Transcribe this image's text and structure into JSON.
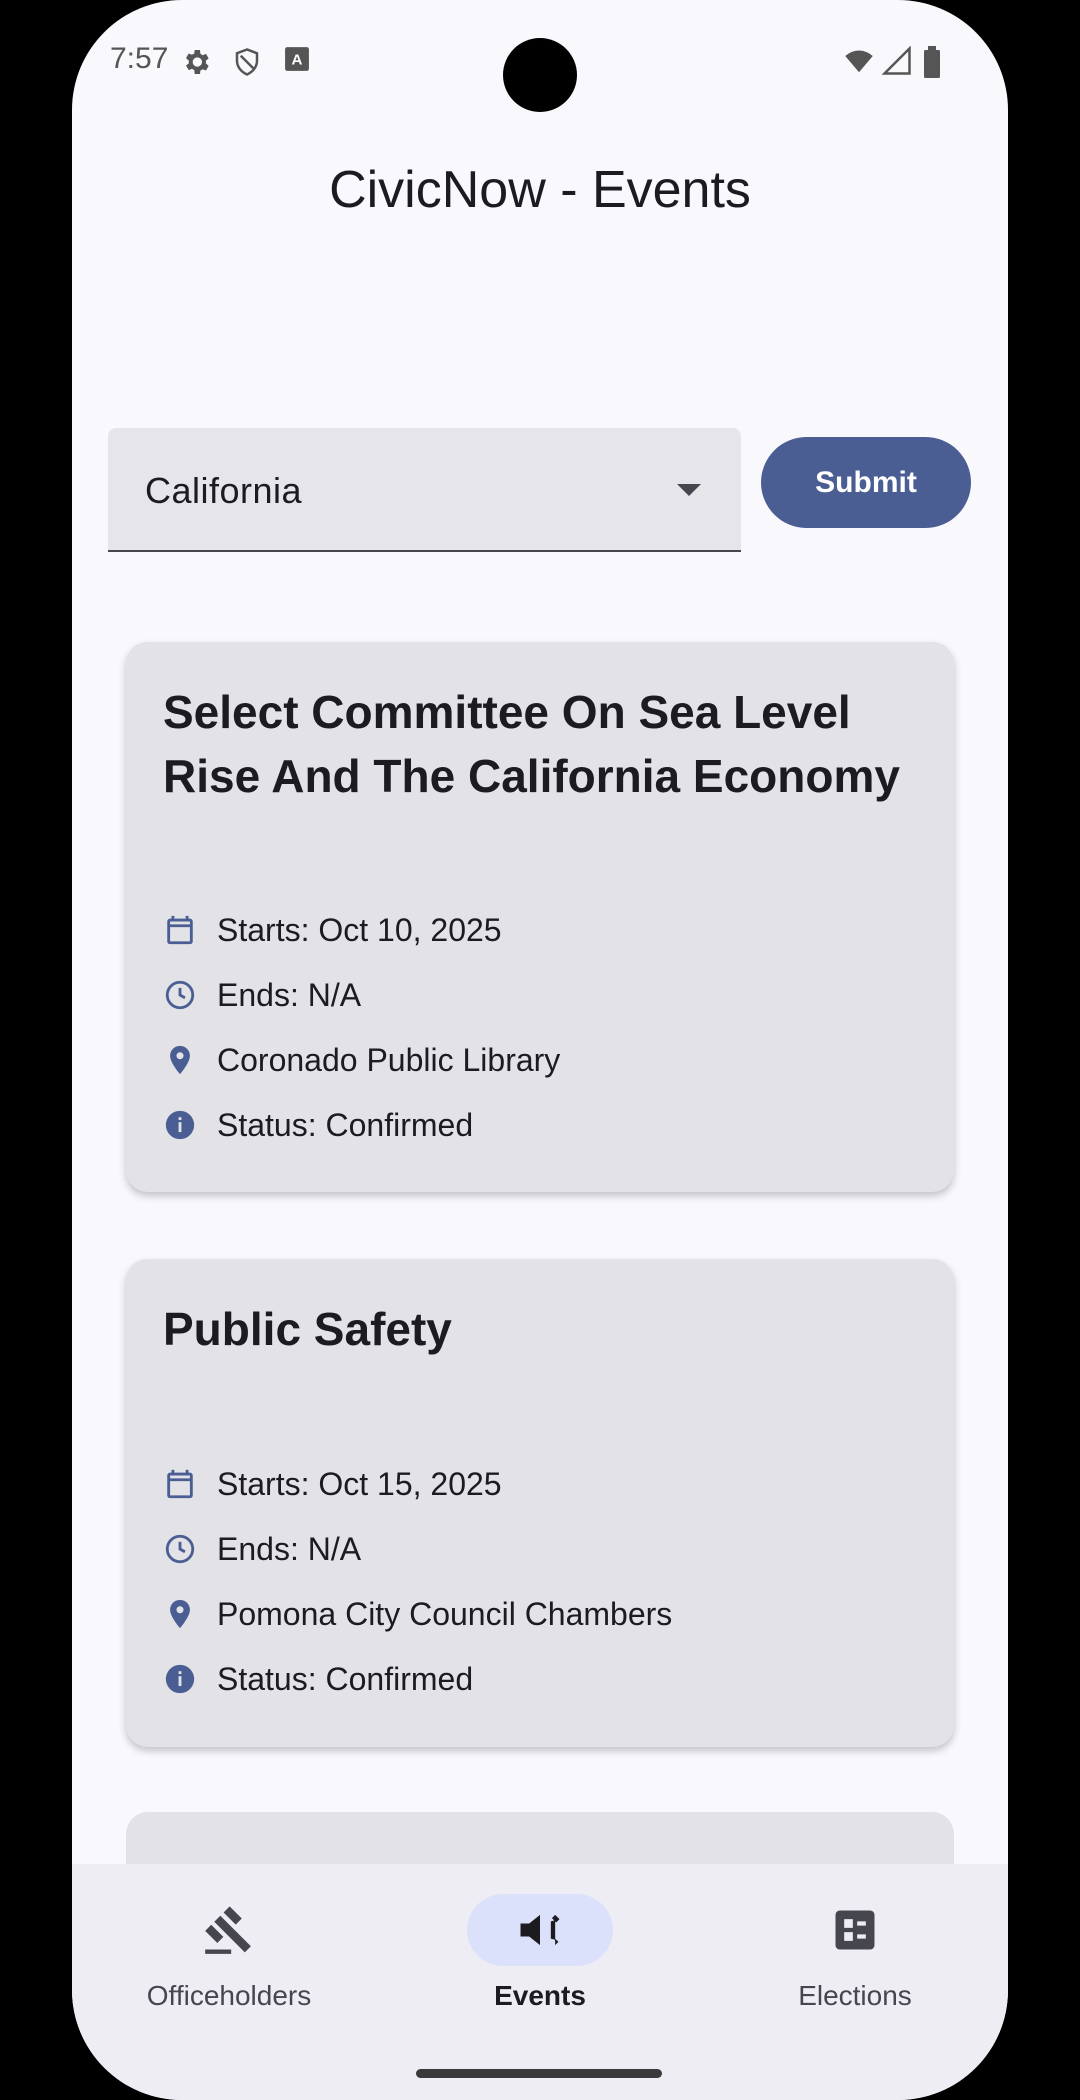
{
  "status_bar": {
    "time": "7:57"
  },
  "app": {
    "title": "CivicNow - Events"
  },
  "filter": {
    "selected_state": "California",
    "submit_label": "Submit"
  },
  "events": [
    {
      "title": "Select Committee On Sea Level Rise And The California Economy",
      "starts": "Starts: Oct 10, 2025",
      "ends": "Ends: N/A",
      "location": "Coronado Public Library",
      "status": "Status: Confirmed"
    },
    {
      "title": "Public Safety",
      "starts": "Starts: Oct 15, 2025",
      "ends": "Ends: N/A",
      "location": "Pomona City Council Chambers",
      "status": "Status: Confirmed"
    }
  ],
  "bottom_nav": {
    "items": [
      {
        "label": "Officeholders",
        "icon": "gavel-icon",
        "active": false
      },
      {
        "label": "Events",
        "icon": "campaign-icon",
        "active": true
      },
      {
        "label": "Elections",
        "icon": "ballot-icon",
        "active": false
      }
    ]
  },
  "colors": {
    "accent": "#4a5e94",
    "card": "#e2e2e7",
    "background": "#f9f8fd",
    "nav_active_pill": "#dbe1fa"
  }
}
